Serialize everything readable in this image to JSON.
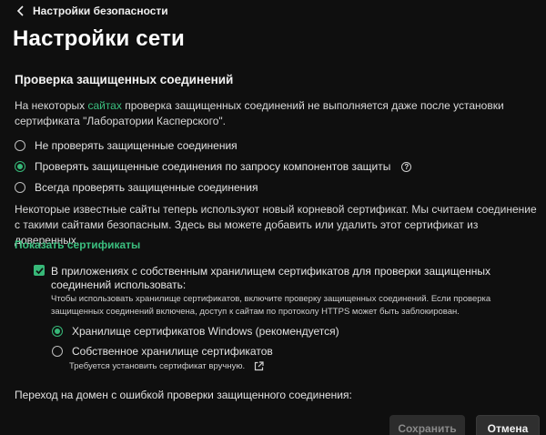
{
  "nav": {
    "back_label": "Настройки безопасности"
  },
  "page": {
    "title": "Настройки сети"
  },
  "secure_connections": {
    "heading": "Проверка защищенных соединений",
    "intro_prefix": "На некоторых ",
    "intro_link": "сайтах",
    "intro_suffix": " проверка защищенных соединений не выполняется даже после установки сертификата \"Лаборатории Касперского\".",
    "options": [
      {
        "label": "Не проверять защищенные соединения",
        "selected": false
      },
      {
        "label": "Проверять защищенные соединения по запросу компонентов защиты",
        "selected": true
      },
      {
        "label": "Всегда проверять защищенные соединения",
        "selected": false
      }
    ],
    "root_cert_note": "Некоторые известные сайты теперь используют новый корневой сертификат. Мы считаем соединение с такими сайтами безопасным. Здесь вы можете добавить или удалить этот сертификат из доверенных.",
    "show_certs_link": "Показать сертификаты"
  },
  "cert_store": {
    "checkbox_checked": true,
    "checkbox_label": "В приложениях с собственным хранилищем сертификатов для проверки защищенных соединений использовать:",
    "note": "Чтобы использовать хранилище сертификатов, включите проверку защищенных соединений. Если проверка защищенных соединений включена, доступ к сайтам по протоколу HTTPS может быть заблокирован.",
    "options": [
      {
        "label": "Хранилище сертификатов Windows (рекомендуется)",
        "selected": true
      },
      {
        "label": "Собственное хранилище сертификатов",
        "selected": false
      }
    ],
    "own_store_note": "Требуется установить сертификат вручную."
  },
  "domain_error": {
    "label": "Переход на домен с ошибкой проверки защищенного соединения:"
  },
  "buttons": {
    "save": "Сохранить",
    "cancel": "Отмена"
  },
  "colors": {
    "accent": "#37b878",
    "background": "#0f0f0f",
    "link": "#3bbf7f"
  }
}
